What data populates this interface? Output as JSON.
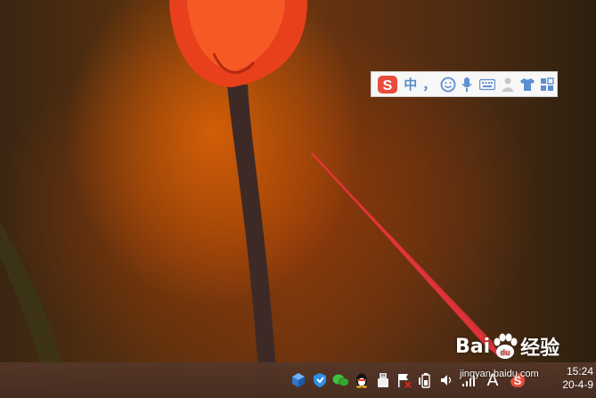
{
  "ime_toolbar": {
    "items": [
      "s-logo-icon",
      "中",
      "，",
      "emoji-icon",
      "microphone-icon",
      "keyboard-icon",
      "user-icon",
      "skin-shirt-icon",
      "toolbox-grid-icon"
    ],
    "mode_label": "中",
    "punct_label": "，"
  },
  "taskbar": {
    "tray_icons": [
      "cube-icon",
      "shield-icon",
      "wechat-icon",
      "qq-penguin-icon",
      "usb-device-icon",
      "flag-icon",
      "battery-icon",
      "volume-icon",
      "network-signal-icon",
      "input-language-icon",
      "sogou-ime-icon"
    ],
    "input_indicator": "A"
  },
  "clock": {
    "time": "15:24",
    "date": "20-4-9"
  },
  "watermark": {
    "brand": "Bai",
    "brand_tail": "经验",
    "url": "jingyan.baidu.com"
  },
  "colors": {
    "arrow": "#e8343c",
    "ime_accent": "#5b8fd0",
    "sogou_red": "#e94c3d"
  }
}
